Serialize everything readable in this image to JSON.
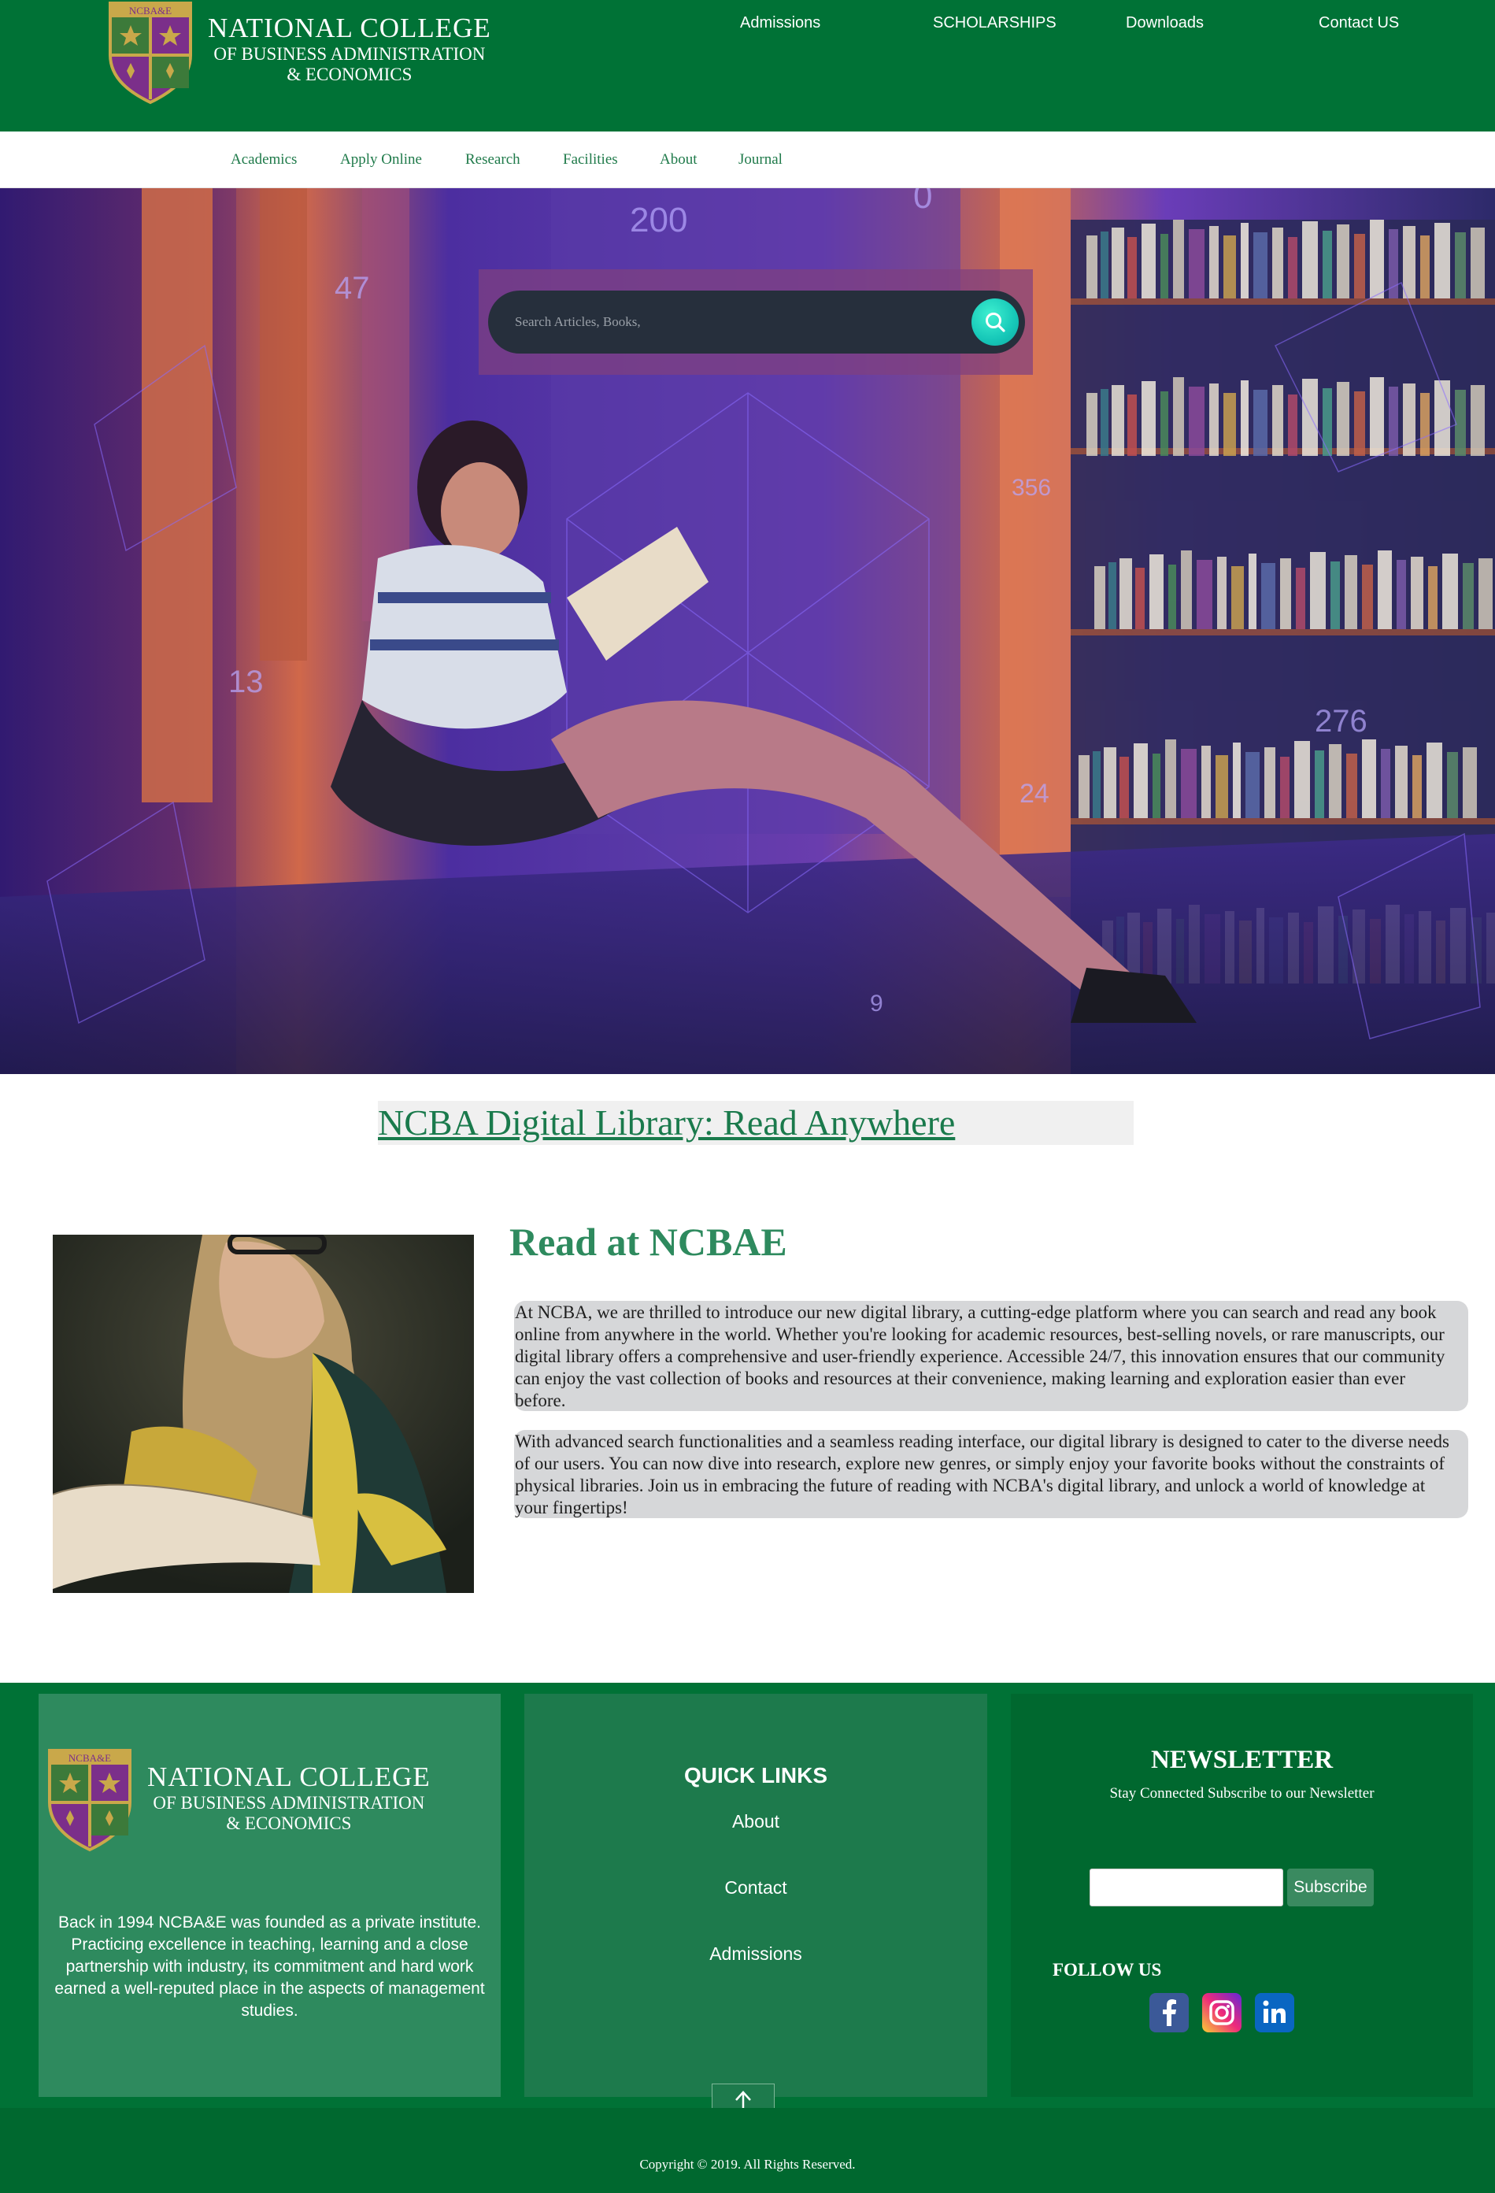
{
  "brand": {
    "crest_text": "NCBA&E",
    "line1": "NATIONAL COLLEGE",
    "line2": "OF BUSINESS ADMINISTRATION",
    "line3": "& ECONOMICS"
  },
  "top_nav": [
    {
      "label": "Admissions"
    },
    {
      "label": "SCHOLARSHIPS"
    },
    {
      "label": "Downloads"
    },
    {
      "label": "Contact US"
    }
  ],
  "sub_nav": [
    {
      "label": "Academics"
    },
    {
      "label": "Apply Online"
    },
    {
      "label": "Research"
    },
    {
      "label": "Facilities"
    },
    {
      "label": "About"
    },
    {
      "label": "Journal"
    }
  ],
  "search": {
    "placeholder": "Search Articles, Books,",
    "button_icon": "search-icon"
  },
  "library_title": "NCBA Digital Library: Read Anywhere",
  "about": {
    "heading": "Read at NCBAE",
    "paragraphs": [
      "At NCBA, we are thrilled to introduce our new digital library, a cutting-edge platform where you can search and read any book online from anywhere in the world. Whether you're looking for academic resources, best-selling novels, or rare manuscripts, our digital library offers a comprehensive and user-friendly experience. Accessible 24/7, this innovation ensures that our community can enjoy the vast collection of books and resources at their convenience, making learning and exploration easier than ever before.",
      "With advanced search functionalities and a seamless reading interface, our digital library is designed to cater to the diverse needs of our users. You can now dive into research, explore new genres, or simply enjoy your favorite books without the constraints of physical libraries. Join us in embracing the future of reading with NCBA's digital library, and unlock a world of knowledge at your fingertips!"
    ]
  },
  "footer": {
    "about_text": "Back in 1994 NCBA&E was founded as a private institute. Practicing excellence in teaching, learning and a close partnership with industry, its commitment and hard work earned a well-reputed place in the aspects of management studies.",
    "quick_links_title": "QUICK LINKS",
    "quick_links": [
      {
        "label": "About"
      },
      {
        "label": "Contact"
      },
      {
        "label": "Admissions"
      }
    ],
    "newsletter_title": "NEWSLETTER",
    "newsletter_subtitle": "Stay Connected Subscribe to our Newsletter",
    "subscribe_label": "Subscribe",
    "follow_label": "FOLLOW US",
    "social": [
      {
        "icon": "facebook-icon",
        "color": "#3b5998"
      },
      {
        "icon": "instagram-icon",
        "color": "#e1306c"
      },
      {
        "icon": "linkedin-icon",
        "color": "#0a66c2"
      }
    ],
    "back_to_top_icon": "arrow-up-icon",
    "copyright": "Copyright © 2019. All Rights Reserved."
  },
  "colors": {
    "header_green": "#007236",
    "accent_green": "#1a7a4c",
    "footer_col1": "#2e8a5e",
    "footer_col2": "#1d7a4c",
    "footer_col3": "#00682f",
    "search_button": "#16c7b8"
  }
}
